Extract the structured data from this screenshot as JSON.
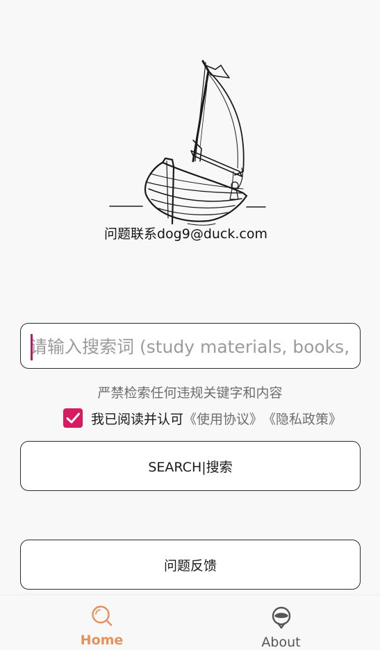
{
  "header": {
    "contact_text": "问题联系dog9@duck.com"
  },
  "search": {
    "placeholder": "请输入搜索词 (study materials, books, ...)",
    "value": ""
  },
  "notice": {
    "warning_text": "严禁检索任何违规关键字和内容"
  },
  "agreement": {
    "checked": true,
    "label": "我已阅读并认可",
    "terms_link": "《使用协议》",
    "privacy_link": "《隐私政策》"
  },
  "buttons": {
    "search_label": "SEARCH|搜索",
    "feedback_label": "问题反馈"
  },
  "bottom_nav": {
    "items": [
      {
        "label": "Home",
        "icon": "search-icon",
        "active": true
      },
      {
        "label": "About",
        "icon": "about-icon",
        "active": false
      }
    ]
  },
  "colors": {
    "accent_active": "#e5915b",
    "checkbox": "#d81b60",
    "caret": "#c2185b",
    "background": "#f8f8f8"
  }
}
